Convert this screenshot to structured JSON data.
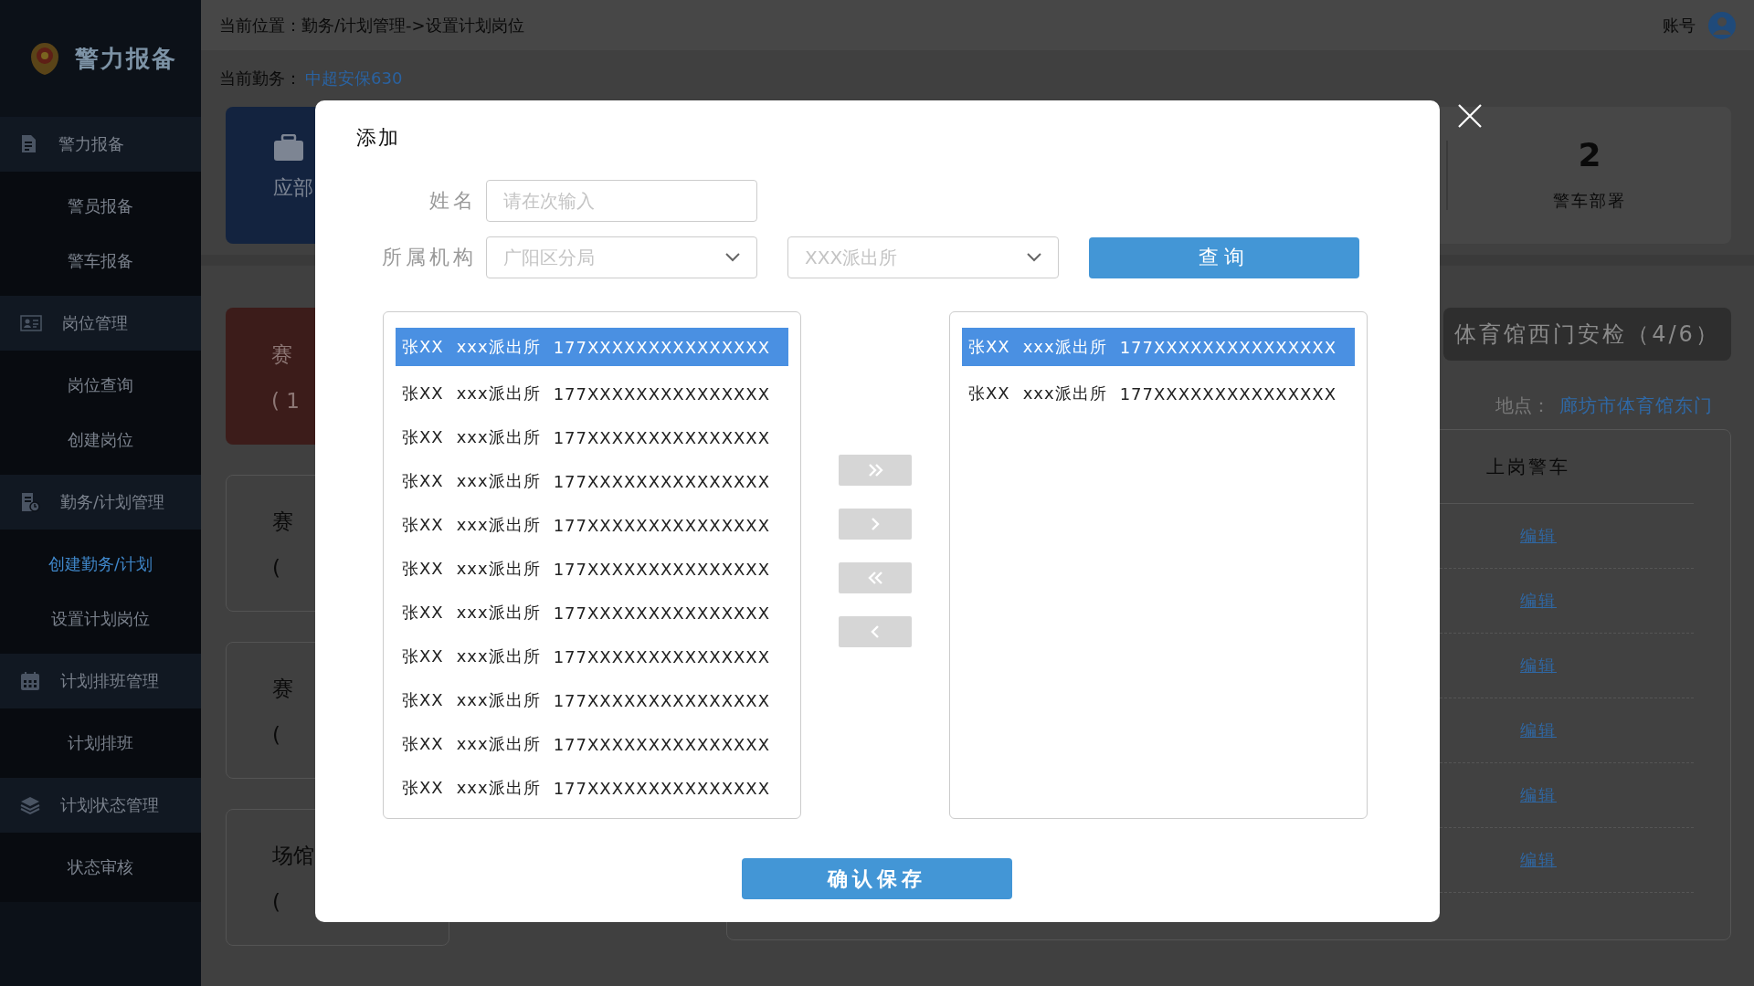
{
  "sidebar": {
    "logo_text": "警力报备",
    "groups": [
      {
        "label": "警力报备",
        "children": [
          {
            "label": "警员报备",
            "selected": false
          },
          {
            "label": "警车报备",
            "selected": false
          }
        ]
      },
      {
        "label": "岗位管理",
        "children": [
          {
            "label": "岗位查询",
            "selected": false
          },
          {
            "label": "创建岗位",
            "selected": false
          }
        ]
      },
      {
        "label": "勤务/计划管理",
        "children": [
          {
            "label": "创建勤务/计划",
            "selected": true
          },
          {
            "label": "设置计划岗位",
            "selected": false
          }
        ]
      },
      {
        "label": "计划排班管理",
        "children": [
          {
            "label": "计划排班",
            "selected": false
          }
        ]
      },
      {
        "label": "计划状态管理",
        "children": [
          {
            "label": "状态审核",
            "selected": false
          }
        ]
      }
    ]
  },
  "breadcrumb": {
    "label": "当前位置：",
    "path": "勤务/计划管理->设置计划岗位"
  },
  "account": "账号",
  "current_duty": {
    "label": "当前勤务：",
    "value": "中超安保630"
  },
  "summary": {
    "primary_card": "应部",
    "stat": {
      "value": "2",
      "label": "警车部署"
    }
  },
  "post_cards": [
    {
      "kind": "alert",
      "lines": [
        "赛",
        "( 1"
      ]
    },
    {
      "kind": "plain",
      "lines": [
        "赛",
        "("
      ]
    },
    {
      "kind": "plain",
      "lines": [
        "赛",
        "("
      ]
    },
    {
      "kind": "plain",
      "lines": [
        "场馆",
        "("
      ]
    }
  ],
  "post_button": "体育馆西门安检（4/6）",
  "location": {
    "label": "地点：",
    "value": "廊坊市体育馆东门"
  },
  "table": {
    "header": "上岗警车",
    "rows": [
      "编辑",
      "编辑",
      "编辑",
      "编辑",
      "编辑",
      "编辑"
    ]
  },
  "dialog": {
    "title": "添加",
    "name_field": {
      "label": "姓名",
      "placeholder": "请在次输入"
    },
    "org_field": {
      "label": "所属机构",
      "selects": [
        {
          "placeholder": "广阳区分局"
        },
        {
          "placeholder": "XXX派出所"
        }
      ]
    },
    "query_button": "查询",
    "left_list": [
      {
        "name": "张XX",
        "station": "xxx派出所",
        "phone": "177XXXXXXXXXXXXXXX",
        "selected": true
      },
      {
        "name": "张XX",
        "station": "xxx派出所",
        "phone": "177XXXXXXXXXXXXXXX",
        "selected": false
      },
      {
        "name": "张XX",
        "station": "xxx派出所",
        "phone": "177XXXXXXXXXXXXXXX",
        "selected": false
      },
      {
        "name": "张XX",
        "station": "xxx派出所",
        "phone": "177XXXXXXXXXXXXXXX",
        "selected": false
      },
      {
        "name": "张XX",
        "station": "xxx派出所",
        "phone": "177XXXXXXXXXXXXXXX",
        "selected": false
      },
      {
        "name": "张XX",
        "station": "xxx派出所",
        "phone": "177XXXXXXXXXXXXXXX",
        "selected": false
      },
      {
        "name": "张XX",
        "station": "xxx派出所",
        "phone": "177XXXXXXXXXXXXXXX",
        "selected": false
      },
      {
        "name": "张XX",
        "station": "xxx派出所",
        "phone": "177XXXXXXXXXXXXXXX",
        "selected": false
      },
      {
        "name": "张XX",
        "station": "xxx派出所",
        "phone": "177XXXXXXXXXXXXXXX",
        "selected": false
      },
      {
        "name": "张XX",
        "station": "xxx派出所",
        "phone": "177XXXXXXXXXXXXXXX",
        "selected": false
      },
      {
        "name": "张XX",
        "station": "xxx派出所",
        "phone": "177XXXXXXXXXXXXXXX",
        "selected": false
      }
    ],
    "transfer_buttons": [
      {
        "kind": "all-right"
      },
      {
        "kind": "right"
      },
      {
        "kind": "all-left"
      },
      {
        "kind": "left"
      }
    ],
    "right_list": [
      {
        "name": "张XX",
        "station": "xxx派出所",
        "phone": "177XXXXXXXXXXXXXXX",
        "selected": true
      },
      {
        "name": "张XX",
        "station": "xxx派出所",
        "phone": "177XXXXXXXXXXXXXXX",
        "selected": false
      }
    ],
    "save_button": "确认保存"
  }
}
